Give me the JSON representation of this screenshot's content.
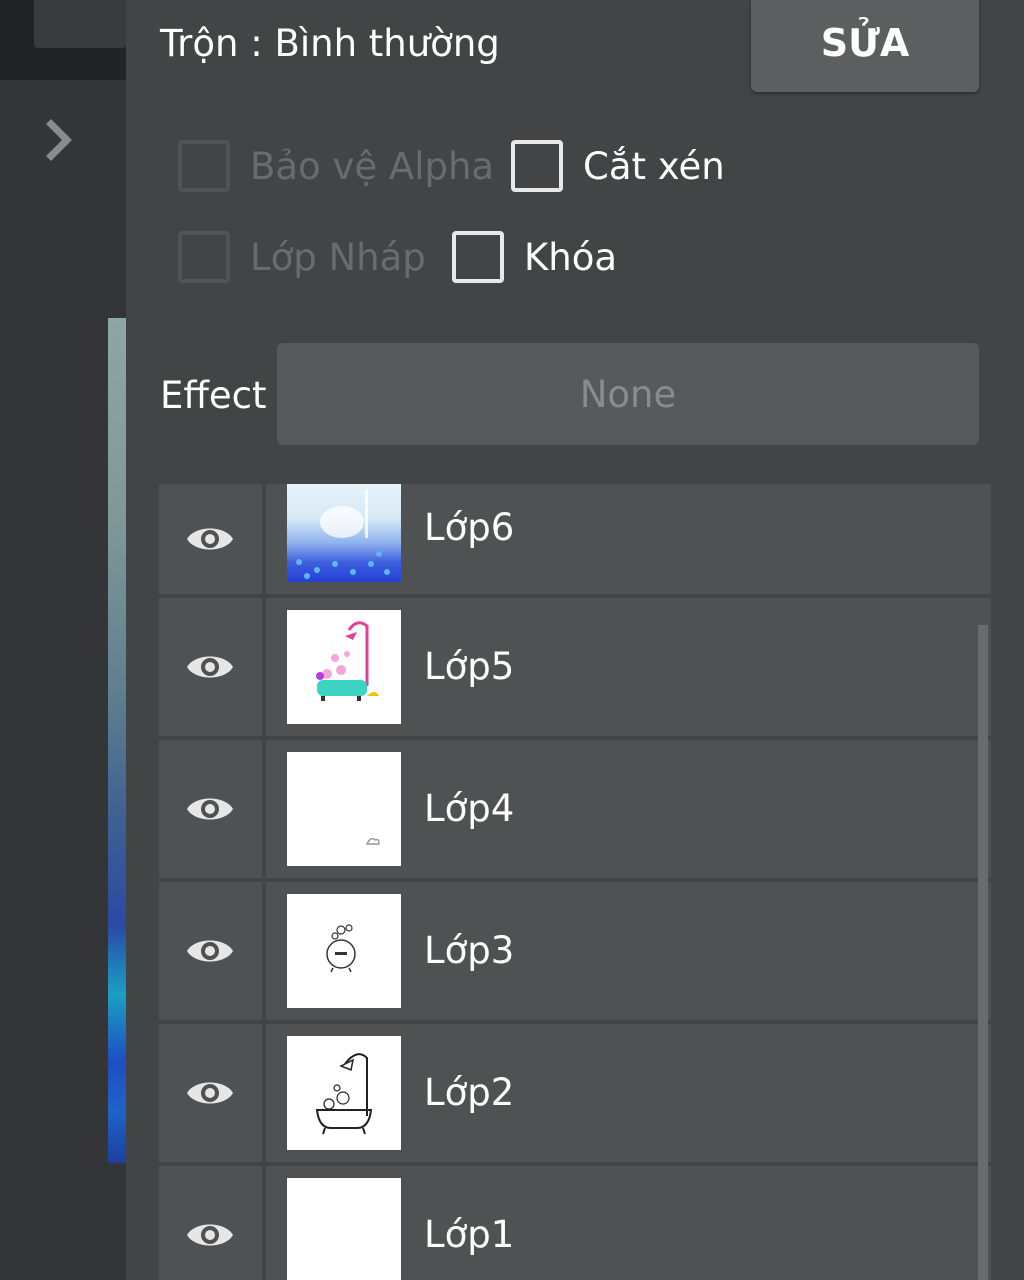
{
  "blend": {
    "label": "Trộn : Bình thường"
  },
  "edit_button": {
    "label": "SỬA"
  },
  "options": {
    "alpha_protect": {
      "label": "Bảo vệ Alpha",
      "checked": false,
      "enabled": false
    },
    "clipping": {
      "label": "Cắt xén",
      "checked": false,
      "enabled": true
    },
    "draft_layer": {
      "label": "Lớp Nháp",
      "checked": false,
      "enabled": false
    },
    "lock": {
      "label": "Khóa",
      "checked": false,
      "enabled": true
    }
  },
  "effect": {
    "label": "Effect",
    "value": "None"
  },
  "layers": [
    {
      "name": "Lớp6",
      "visible": true
    },
    {
      "name": "Lớp5",
      "visible": true
    },
    {
      "name": "Lớp4",
      "visible": true
    },
    {
      "name": "Lớp3",
      "visible": true
    },
    {
      "name": "Lớp2",
      "visible": true
    },
    {
      "name": "Lớp1",
      "visible": true
    }
  ],
  "icons": {
    "expand": "chevron-right-icon",
    "visibility": "eye-icon"
  },
  "colors": {
    "panel": "#434446",
    "row": "#505153",
    "button": "#5d5e60",
    "text": "#ffffff",
    "disabled_text": "#6a6b6d"
  }
}
